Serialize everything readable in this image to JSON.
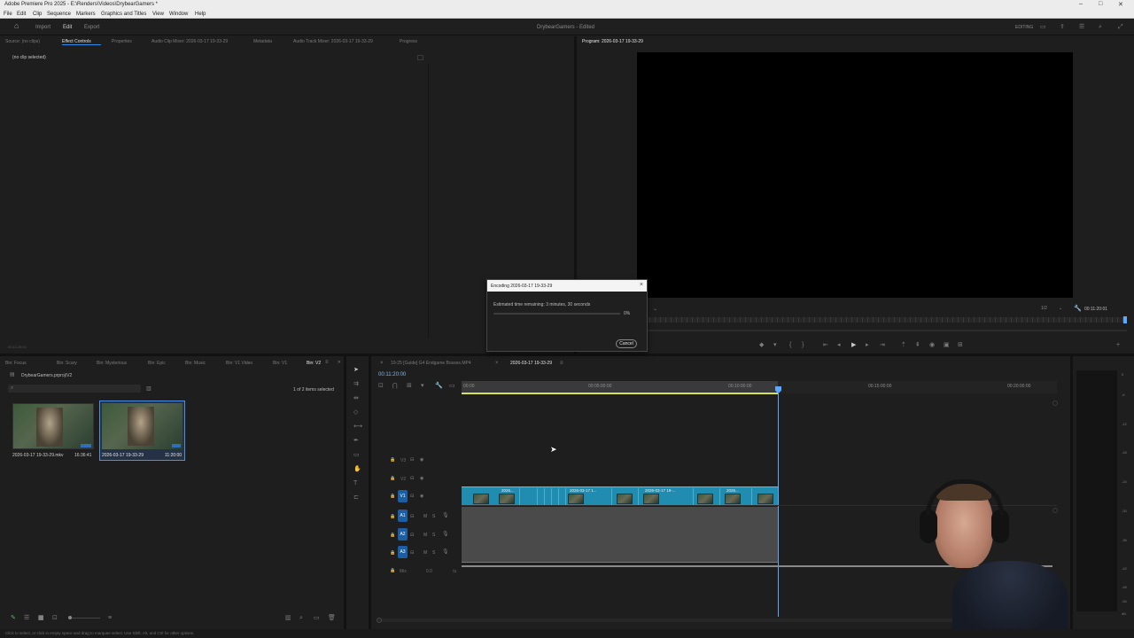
{
  "window": {
    "title": "Adobe Premiere Pro 2025 - E:\\Renders\\Videos\\DrybearGamers *",
    "minimize": "–",
    "maximize": "□",
    "close": "✕"
  },
  "menu": [
    "File",
    "Edit",
    "Clip",
    "Sequence",
    "Markers",
    "Graphics and Titles",
    "View",
    "Window",
    "Help"
  ],
  "workspace": {
    "tabs": [
      "Import",
      "Edit",
      "Export"
    ],
    "active": "Edit",
    "project_title": "DrybearGamers - Edited",
    "mode": "EDITING"
  },
  "source_panel": {
    "tabs": [
      "Source: (no clips)",
      "Effect Controls",
      "Properties",
      "Audio Clip Mixer: 2026-03-17 19-33-29",
      "Metadata",
      "Audio Track Mixer: 2026-03-17 19-33-29",
      "Progress"
    ],
    "active_tab": "Effect Controls",
    "no_clip_text": "(no clip selected)",
    "timecode": "00:11:20:00"
  },
  "program_monitor": {
    "tab": "Program: 2026-03-17 19-33-29",
    "resolution": "1/2",
    "timecode": "00:11:20:01"
  },
  "encode_dialog": {
    "title": "Encoding 2026-03-17 19-33-29",
    "estimate": "Estimated time remaining: 3 minutes, 30 seconds",
    "percent": "0%",
    "progress": 0,
    "cancel_label": "Cancel"
  },
  "project_panel": {
    "tabs": [
      "Bin: Focus",
      "Bin: Scary",
      "Bin: Mysterious",
      "Bin: Epic",
      "Bin: Music",
      "Bin: V1 Video",
      "Bin: V1",
      "Bin: V2"
    ],
    "active_tab": "Bin: V2",
    "path": "DrybearGamers.prproj\\V2",
    "selection_count": "1 of 2 items selected",
    "items": [
      {
        "name": "2026-03-17 19-33-29.mkv",
        "duration": "16:36:41"
      },
      {
        "name": "2026-03-17 19-33-29",
        "duration": "11:20:00"
      }
    ]
  },
  "timeline": {
    "tabs": [
      "10-25 [Guide] G4 Endgame Bosses.MP4",
      "2026-03-17 19-33-29"
    ],
    "active_tab": "2026-03-17 19-33-29",
    "timecode": "00:11:20:00",
    "ruler": [
      "00:00",
      "00:05:00:00",
      "00:10:00:00",
      "00:15:00:00",
      "00:20:00:00"
    ],
    "video_tracks": [
      "V3",
      "V2",
      "V1"
    ],
    "audio_tracks": [
      "A1",
      "A2",
      "A3"
    ],
    "mix_label": "Mix",
    "mix_value": "0.0",
    "clips": [
      "2026...",
      "2026-03-17 1...",
      "2026-03-17 19-...",
      "2026..."
    ]
  },
  "vu_meter": {
    "ticks": [
      "0",
      "-6",
      "-12",
      "-18",
      "-24",
      "-30",
      "-36",
      "-42",
      "-48",
      "-54",
      "dB"
    ]
  },
  "status_bar": {
    "text": "Click to select, or click in empty space and drag to marquee select. Use Shift, Alt, and Ctrl for other options."
  },
  "colors": {
    "accent": "#2d8ceb",
    "clip_video": "#1f8cb0",
    "clip_audio": "#4a4a4a",
    "playhead": "#5aa8ff",
    "work_area": "#d6e05a",
    "dialog_header": "#f4f4f4"
  }
}
